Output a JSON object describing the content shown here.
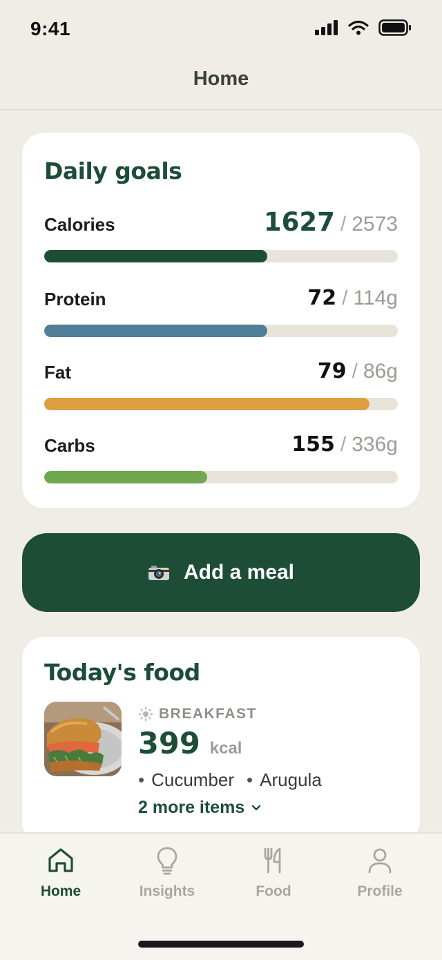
{
  "status": {
    "time": "9:41"
  },
  "header": {
    "title": "Home"
  },
  "daily_goals": {
    "title": "Daily goals",
    "calories": {
      "label": "Calories",
      "current": "1627",
      "target": "2573",
      "progress": 0.63,
      "color": "#1d4d36"
    },
    "protein": {
      "label": "Protein",
      "current": "72",
      "target": "114g",
      "progress": 0.63,
      "color": "#4f7e96"
    },
    "fat": {
      "label": "Fat",
      "current": "79",
      "target": "86g",
      "progress": 0.92,
      "color": "#dd9e42"
    },
    "carbs": {
      "label": "Carbs",
      "current": "155",
      "target": "336g",
      "progress": 0.46,
      "color": "#6fa84e"
    }
  },
  "add_meal": {
    "label": "Add a meal",
    "icon": "camera-icon"
  },
  "todays_food": {
    "title": "Today's food",
    "meal": {
      "type": "BREAKFAST",
      "icon": "sun-icon",
      "kcal": "399",
      "unit": "kcal",
      "items": [
        "Cucumber",
        "Arugula"
      ],
      "more": "2 more items"
    }
  },
  "tabs": [
    {
      "label": "Home",
      "icon": "home-icon",
      "active": true
    },
    {
      "label": "Insights",
      "icon": "lightbulb-icon",
      "active": false
    },
    {
      "label": "Food",
      "icon": "fork-knife-icon",
      "active": false
    },
    {
      "label": "Profile",
      "icon": "person-icon",
      "active": false
    }
  ]
}
